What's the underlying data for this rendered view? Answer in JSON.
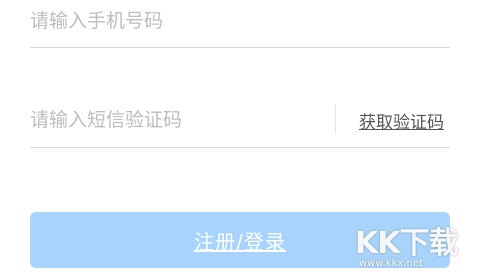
{
  "phone_field": {
    "placeholder": "请输入手机号码",
    "value": ""
  },
  "code_field": {
    "placeholder": "请输入短信验证码",
    "value": "",
    "get_code_label": "获取验证码"
  },
  "submit_button": {
    "label": "注册/登录",
    "color": "#a8d4fb"
  },
  "watermark": {
    "logo_text": "KK下载",
    "url": "www.kkx.net"
  },
  "colors": {
    "placeholder": "#bdbdbd",
    "link": "#555555",
    "button": "#a8d4fb"
  }
}
